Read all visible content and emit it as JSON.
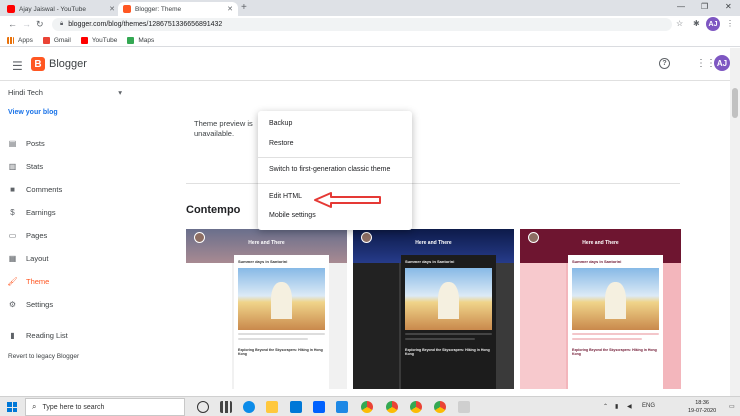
{
  "browser": {
    "tabs": [
      {
        "title": "Ajay Jaiswal - YouTube",
        "active": false
      },
      {
        "title": "Blogger: Theme",
        "active": true
      }
    ],
    "url": "blogger.com/blog/themes/1286751336656891432",
    "bookmarks": [
      "Apps",
      "Gmail",
      "YouTube",
      "Maps"
    ],
    "profile_initial": "AJ"
  },
  "header": {
    "app_name": "Blogger",
    "logo_letter": "B",
    "avatar_initial": "AJ"
  },
  "sidebar": {
    "blog_name": "Hindi Tech",
    "view_blog": "View your blog",
    "items": [
      {
        "label": "Posts",
        "icon": "posts-icon"
      },
      {
        "label": "Stats",
        "icon": "stats-icon"
      },
      {
        "label": "Comments",
        "icon": "comments-icon"
      },
      {
        "label": "Earnings",
        "icon": "earnings-icon"
      },
      {
        "label": "Pages",
        "icon": "pages-icon"
      },
      {
        "label": "Layout",
        "icon": "layout-icon"
      },
      {
        "label": "Theme",
        "icon": "theme-icon",
        "active": true
      },
      {
        "label": "Settings",
        "icon": "settings-icon"
      },
      {
        "label": "Reading List",
        "icon": "reading-list-icon"
      }
    ],
    "legacy_link": "Revert to legacy Blogger"
  },
  "main": {
    "preview_text": "Theme preview is unavailable.",
    "section_title": "Contempo",
    "themes": [
      {
        "label": "Light",
        "banner_title": "Here and There",
        "post_title": "Summer days in Santorini",
        "post2_title": "Exploring Beyond the Skyscrapers: Hiking in Hong Kong"
      },
      {
        "label": "Dark",
        "banner_title": "Here and There",
        "post_title": "Summer days in Santorini",
        "post2_title": "Exploring Beyond the Skyscrapers: Hiking in Hong Kong"
      },
      {
        "label": "Pink",
        "banner_title": "Here and There",
        "post_title": "Summer days in Santorini",
        "post2_title": "Exploring Beyond the Skyscrapers: Hiking in Hong Kong"
      }
    ]
  },
  "menu": {
    "items": [
      "Backup",
      "Restore",
      "Switch to first-generation classic theme",
      "Edit HTML",
      "Mobile settings"
    ]
  },
  "taskbar": {
    "search_placeholder": "Type here to search",
    "language": "ENG",
    "time": "18:36",
    "date": "19-07-2020"
  },
  "colors": {
    "accent": "#ff5722",
    "link": "#1a73e8",
    "arrow": "#e53935"
  }
}
